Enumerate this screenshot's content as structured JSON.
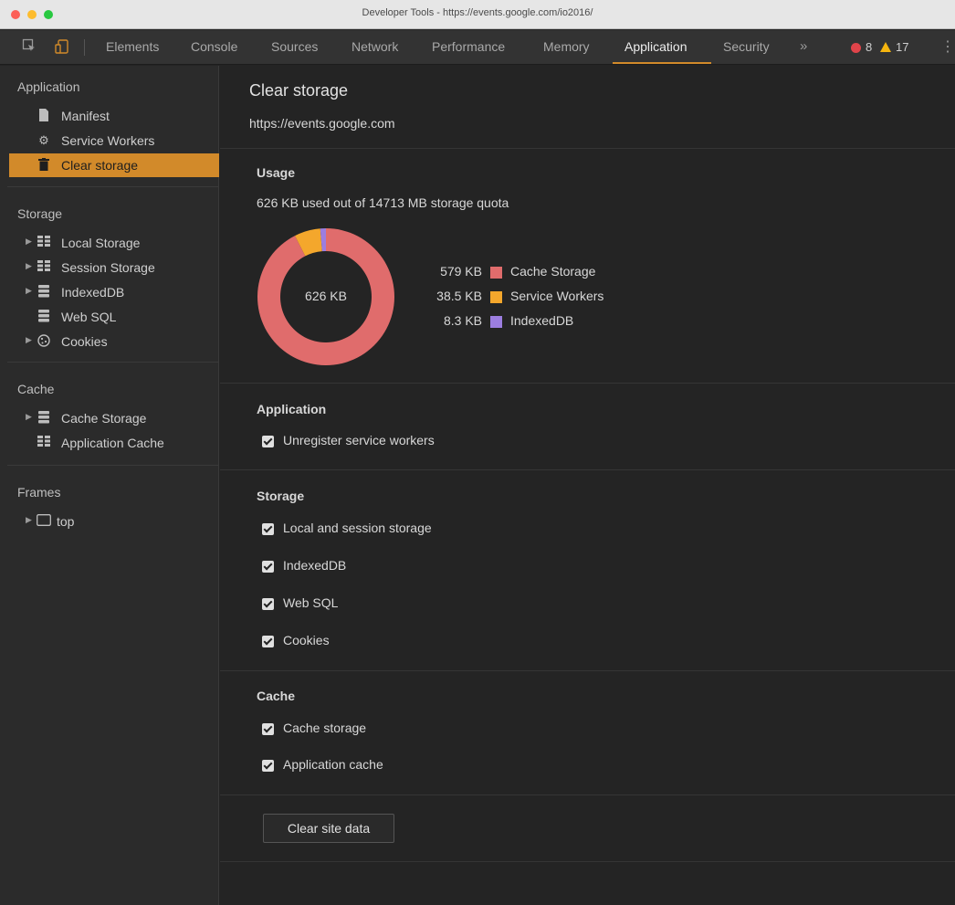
{
  "window": {
    "title": "Developer Tools - https://events.google.com/io2016/"
  },
  "toolbar": {
    "icons": [
      "inspect-element-icon",
      "device-toggle-icon"
    ],
    "tabs": [
      "Elements",
      "Console",
      "Sources",
      "Network",
      "Performance",
      "Memory",
      "Application",
      "Security"
    ],
    "active_tab": "Application",
    "more": "»",
    "errors": "8",
    "warnings": "17",
    "menu": "⋮"
  },
  "sidebar": {
    "application": {
      "title": "Application",
      "items": [
        {
          "label": "Manifest",
          "icon": "document-icon"
        },
        {
          "label": "Service Workers",
          "icon": "gear-icon"
        },
        {
          "label": "Clear storage",
          "icon": "trash-icon",
          "selected": true
        }
      ]
    },
    "storage": {
      "title": "Storage",
      "items": [
        {
          "label": "Local Storage",
          "icon": "grid-icon",
          "expandable": true
        },
        {
          "label": "Session Storage",
          "icon": "grid-icon",
          "expandable": true
        },
        {
          "label": "IndexedDB",
          "icon": "database-icon",
          "expandable": true
        },
        {
          "label": "Web SQL",
          "icon": "database-icon",
          "expandable": false
        },
        {
          "label": "Cookies",
          "icon": "cookie-icon",
          "expandable": true
        }
      ]
    },
    "cache": {
      "title": "Cache",
      "items": [
        {
          "label": "Cache Storage",
          "icon": "database-icon",
          "expandable": true
        },
        {
          "label": "Application Cache",
          "icon": "grid-icon",
          "expandable": false
        }
      ]
    },
    "frames": {
      "title": "Frames",
      "items": [
        {
          "label": "top",
          "icon": "frame-icon",
          "expandable": true
        }
      ]
    }
  },
  "main": {
    "title": "Clear storage",
    "url": "https://events.google.com",
    "usage": {
      "title": "Usage",
      "summary": "626 KB used out of 14713 MB storage quota",
      "total": "626 KB",
      "breakdown": [
        {
          "value": "579 KB",
          "name": "Cache Storage",
          "color": "#e06c6c"
        },
        {
          "value": "38.5 KB",
          "name": "Service Workers",
          "color": "#f4a72c"
        },
        {
          "value": "8.3 KB",
          "name": "IndexedDB",
          "color": "#9c7ee0"
        }
      ]
    },
    "application_group": {
      "title": "Application",
      "options": [
        {
          "label": "Unregister service workers",
          "checked": true
        }
      ]
    },
    "storage_group": {
      "title": "Storage",
      "options": [
        {
          "label": "Local and session storage",
          "checked": true
        },
        {
          "label": "IndexedDB",
          "checked": true
        },
        {
          "label": "Web SQL",
          "checked": true
        },
        {
          "label": "Cookies",
          "checked": true
        }
      ]
    },
    "cache_group": {
      "title": "Cache",
      "options": [
        {
          "label": "Cache storage",
          "checked": true
        },
        {
          "label": "Application cache",
          "checked": true
        }
      ]
    },
    "clear_button": "Clear site data"
  },
  "chart_data": {
    "type": "pie",
    "categories": [
      "Cache Storage",
      "Service Workers",
      "IndexedDB"
    ],
    "values": [
      579,
      38.5,
      8.3
    ],
    "center_label": "626 KB",
    "legend": "right"
  }
}
